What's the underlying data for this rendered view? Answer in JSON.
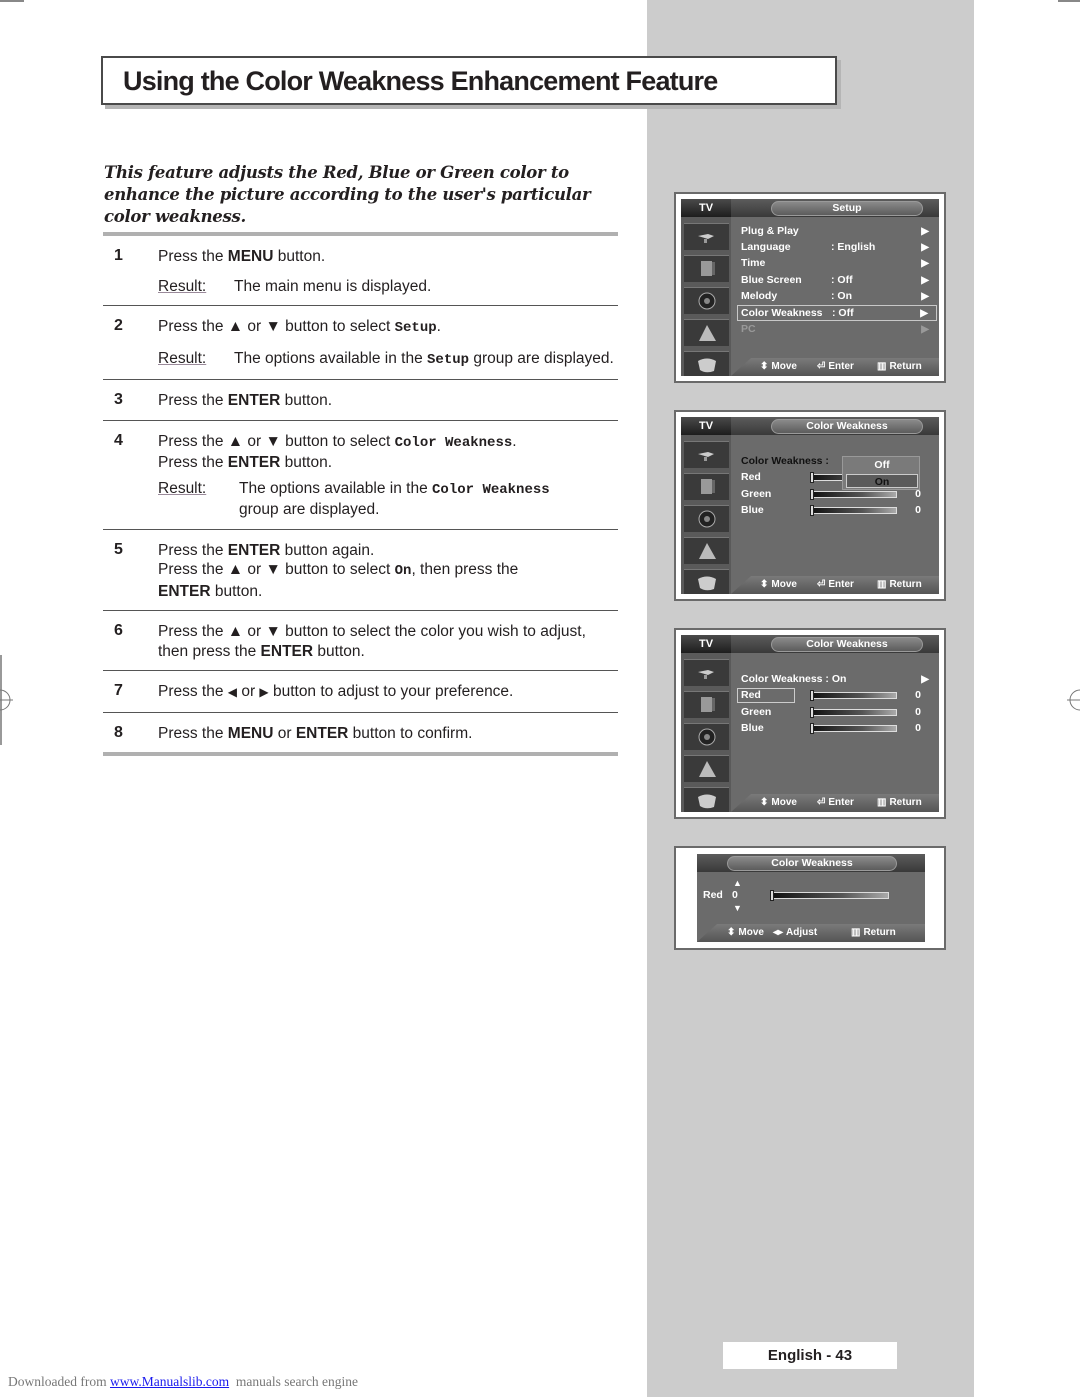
{
  "page": {
    "title": "Using the Color Weakness Enhancement Feature",
    "intro": "This feature adjusts the Red, Blue or Green color to enhance the picture according to the user's particular color weakness.",
    "page_number": "English - 43"
  },
  "steps": [
    {
      "num": "1",
      "line1_pre": "Press the ",
      "line1_bold": "MENU",
      "line1_post": " button.",
      "result_label": "Result:",
      "result": "The main menu is displayed."
    },
    {
      "num": "2",
      "pre": "Press the ",
      "up": "▲",
      "or": " or ",
      "down": "▼",
      "mid": " button to select ",
      "code": "Setup",
      "post": ".",
      "result_label": "Result:",
      "result_pre": "The options available in the ",
      "result_code": "Setup",
      "result_post": " group are displayed."
    },
    {
      "num": "3",
      "pre": "Press the ",
      "bold": "ENTER",
      "post": " button."
    },
    {
      "num": "4",
      "pre": "Press the ",
      "up": "▲",
      "or": " or ",
      "down": "▼",
      "mid": " button to select ",
      "code": "Color Weakness",
      "post": ".",
      "line2_pre": "Press the ",
      "line2_bold": "ENTER",
      "line2_post": " button.",
      "result_label": "Result:",
      "result_pre": "The options available in the ",
      "result_code": "Color Weakness",
      "result_post": "group are displayed."
    },
    {
      "num": "5",
      "pre": "Press the ",
      "bold": "ENTER",
      "post": " button again.",
      "line2_pre": "Press the ",
      "up": "▲",
      "or": " or ",
      "down": "▼",
      "line2_mid": " button to select ",
      "code": "On",
      "line2_post": ", then press the",
      "line3_bold": "ENTER",
      "line3_post": " button."
    },
    {
      "num": "6",
      "pre": "Press the ",
      "up": "▲",
      "or": " or ",
      "down": "▼",
      "mid": " button to select the color you wish to adjust,",
      "line2_pre": "then press the ",
      "line2_bold": "ENTER",
      "line2_post": " button."
    },
    {
      "num": "7",
      "pre": "Press the ",
      "left": "◀",
      "or": " or ",
      "right": "▶",
      "post": " button to adjust to your preference."
    },
    {
      "num": "8",
      "pre": "Press the ",
      "bold1": "MENU",
      "or": " or ",
      "bold2": "ENTER",
      "post": " button to confirm."
    }
  ],
  "osd": {
    "tv_label": "TV",
    "footer": {
      "move": "Move",
      "enter": "Enter",
      "return": "Return",
      "adjust": "Adjust"
    },
    "icons": [
      "plug-icon",
      "picture-icon",
      "speaker-icon",
      "channel-icon",
      "setup-icon"
    ],
    "screen1": {
      "header": "Setup",
      "rows": [
        {
          "label": "Plug & Play",
          "value": "",
          "arrow": "▶"
        },
        {
          "label": "Language",
          "value": ": English",
          "arrow": "▶"
        },
        {
          "label": "Time",
          "value": "",
          "arrow": "▶"
        },
        {
          "label": "Blue Screen",
          "value": ": Off",
          "arrow": "▶"
        },
        {
          "label": "Melody",
          "value": ": On",
          "arrow": "▶"
        },
        {
          "label": "Color Weakness",
          "value": ": Off",
          "arrow": "▶",
          "highlighted": true
        },
        {
          "label": "PC",
          "value": "",
          "arrow": "▶",
          "disabled": true
        }
      ]
    },
    "screen2": {
      "header": "Color Weakness",
      "cw_label": "Color Weakness :",
      "popup_options": [
        "Off",
        "On"
      ],
      "popup_selected": "On",
      "sliders": [
        {
          "label": "Red",
          "value": "0"
        },
        {
          "label": "Green",
          "value": "0"
        },
        {
          "label": "Blue",
          "value": "0"
        }
      ]
    },
    "screen3": {
      "header": "Color Weakness",
      "cw_label": "Color Weakness : On",
      "arrow": "▶",
      "sliders": [
        {
          "label": "Red",
          "value": "0",
          "highlighted": true
        },
        {
          "label": "Green",
          "value": "0"
        },
        {
          "label": "Blue",
          "value": "0"
        }
      ]
    },
    "screen4": {
      "header": "Color Weakness",
      "label": "Red",
      "value": "0",
      "level_fraction": 0
    }
  },
  "footer_note": {
    "pre": "Downloaded from ",
    "link": "www.Manualslib.com",
    "post": "  manuals search engine"
  }
}
